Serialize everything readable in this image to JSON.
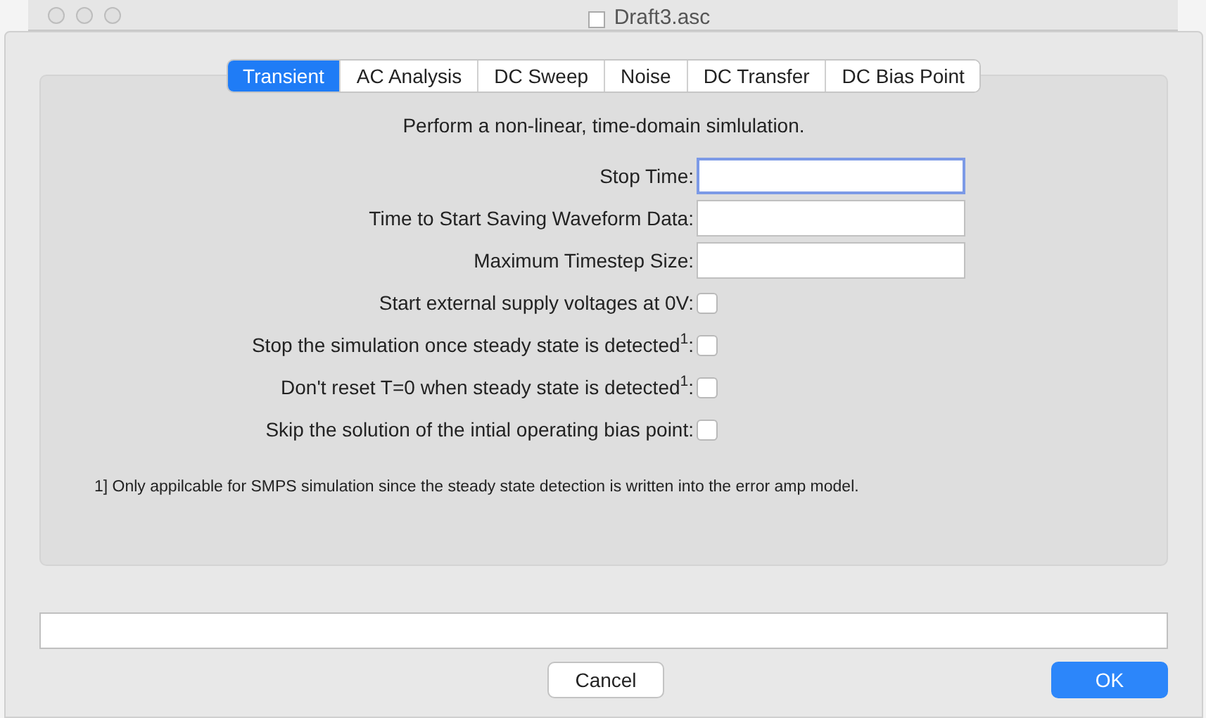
{
  "window": {
    "title": "Draft3.asc"
  },
  "tabs": [
    {
      "label": "Transient",
      "selected": true
    },
    {
      "label": "AC Analysis",
      "selected": false
    },
    {
      "label": "DC Sweep",
      "selected": false
    },
    {
      "label": "Noise",
      "selected": false
    },
    {
      "label": "DC Transfer",
      "selected": false
    },
    {
      "label": "DC Bias Point",
      "selected": false
    }
  ],
  "description": "Perform a non-linear, time-domain simlulation.",
  "fields": [
    {
      "kind": "text",
      "label": "Stop Time:",
      "focused": true
    },
    {
      "kind": "text",
      "label": "Time to Start Saving Waveform Data:",
      "focused": false
    },
    {
      "kind": "text",
      "label": "Maximum Timestep Size:",
      "focused": false
    },
    {
      "kind": "checkbox",
      "label": "Start external supply voltages at 0V:",
      "checked": false
    },
    {
      "kind": "checkbox",
      "label": "Stop the simulation once steady state is detected$^{1}$:",
      "checked": false
    },
    {
      "kind": "checkbox",
      "label": "Don't reset T=0 when steady state is detected$^{1}$:",
      "checked": false
    },
    {
      "kind": "checkbox",
      "label": "Skip  the solution of the intial operating bias point:",
      "checked": false
    }
  ],
  "footnote": "1] Only appilcable for SMPS simulation since the steady state detection is written into the error amp model.",
  "buttons": [
    {
      "label": "Cancel",
      "default": false
    },
    {
      "label": "OK",
      "default": true
    }
  ]
}
